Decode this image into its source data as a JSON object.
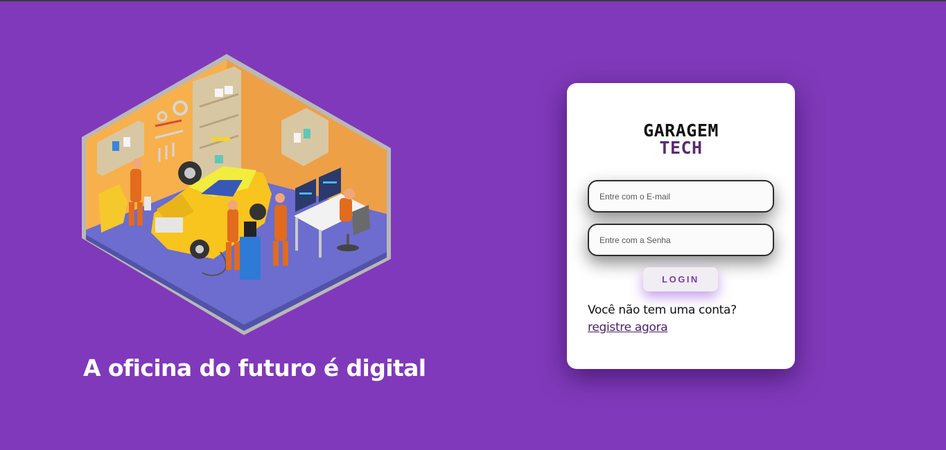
{
  "page": {
    "background_color": "#8039ba"
  },
  "hero": {
    "illustration": "isometric-garage-workshop-illustration",
    "tagline": "A oficina do futuro é digital"
  },
  "login_card": {
    "logo": {
      "line1": "GARAGEM",
      "line2": "TECH"
    },
    "email": {
      "placeholder": "Entre com o E-mail",
      "value": ""
    },
    "password": {
      "placeholder": "Entre com a Senha",
      "value": ""
    },
    "login_label": "LOGIN",
    "signup_prompt": "Você não tem uma conta?",
    "signup_link": "registre agora",
    "accent_color": "#7b3ab0"
  }
}
